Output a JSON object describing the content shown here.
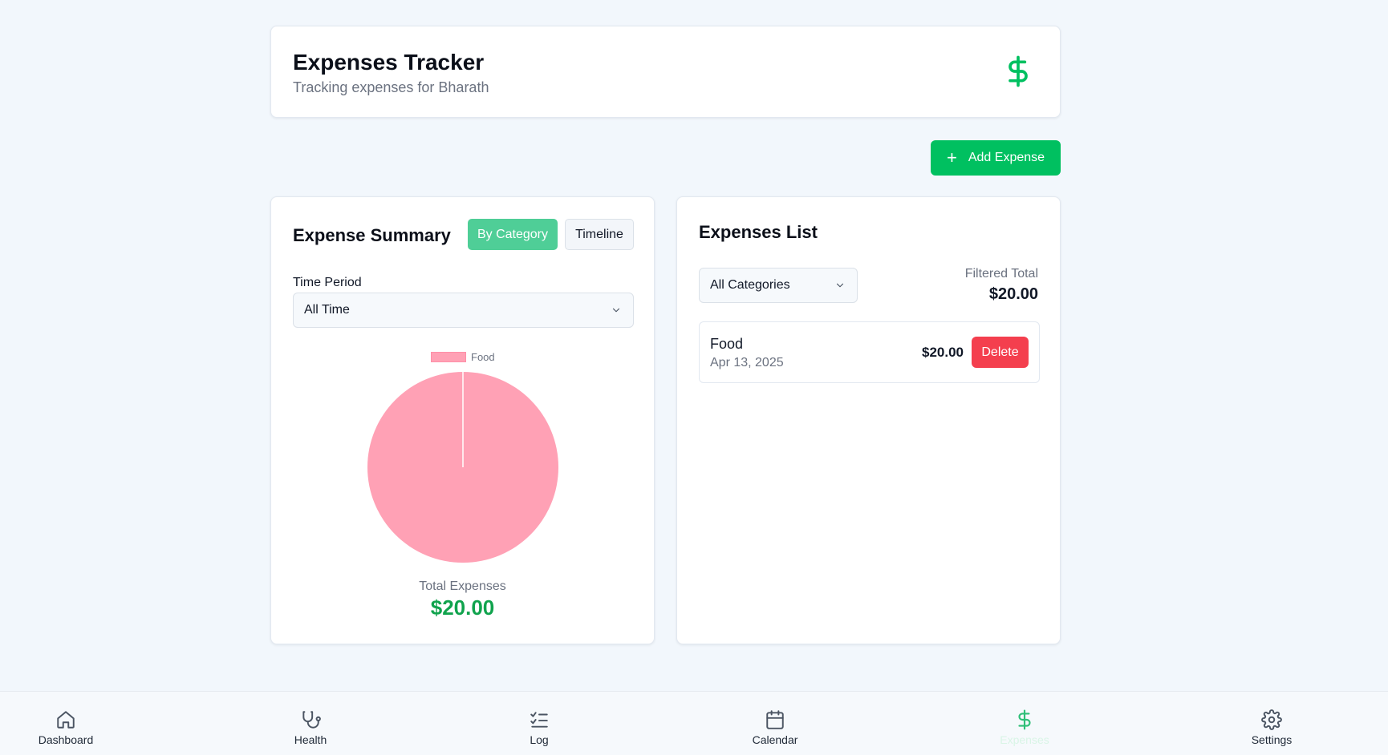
{
  "header": {
    "title": "Expenses Tracker",
    "subtitle": "Tracking expenses for Bharath",
    "icon": "dollar-icon"
  },
  "actions": {
    "add_expense_label": "Add Expense",
    "add_icon": "plus-icon"
  },
  "summary": {
    "title": "Expense Summary",
    "tabs": [
      {
        "label": "By Category",
        "active": true
      },
      {
        "label": "Timeline",
        "active": false
      }
    ],
    "time_period_label": "Time Period",
    "time_period_value": "All Time",
    "total_label": "Total Expenses",
    "total_value": "$20.00"
  },
  "chart_data": {
    "type": "pie",
    "legend": [
      "Food"
    ],
    "legend_position": "top",
    "slices": [
      {
        "label": "Food",
        "value": 20.0,
        "color": "#ffa1b5"
      }
    ]
  },
  "expenses_list": {
    "title": "Expenses List",
    "category_filter_value": "All Categories",
    "filtered_total_label": "Filtered Total",
    "filtered_total_value": "$20.00",
    "items": [
      {
        "category": "Food",
        "date": "Apr 13, 2025",
        "amount": "$20.00",
        "delete_label": "Delete"
      }
    ]
  },
  "nav": {
    "items": [
      {
        "label": "Dashboard",
        "icon": "home-icon",
        "active": false
      },
      {
        "label": "Health",
        "icon": "stethoscope-icon",
        "active": false
      },
      {
        "label": "Log",
        "icon": "checklist-icon",
        "active": false
      },
      {
        "label": "Calendar",
        "icon": "calendar-icon",
        "active": false
      },
      {
        "label": "Expenses",
        "icon": "dollar-icon",
        "active": true
      },
      {
        "label": "Settings",
        "icon": "gear-icon",
        "active": false
      }
    ]
  },
  "colors": {
    "accent": "#00c060",
    "accent_light": "#4fce97",
    "danger": "#f43f4e",
    "total_green": "#10a34d",
    "background": "#f2f7fc"
  }
}
